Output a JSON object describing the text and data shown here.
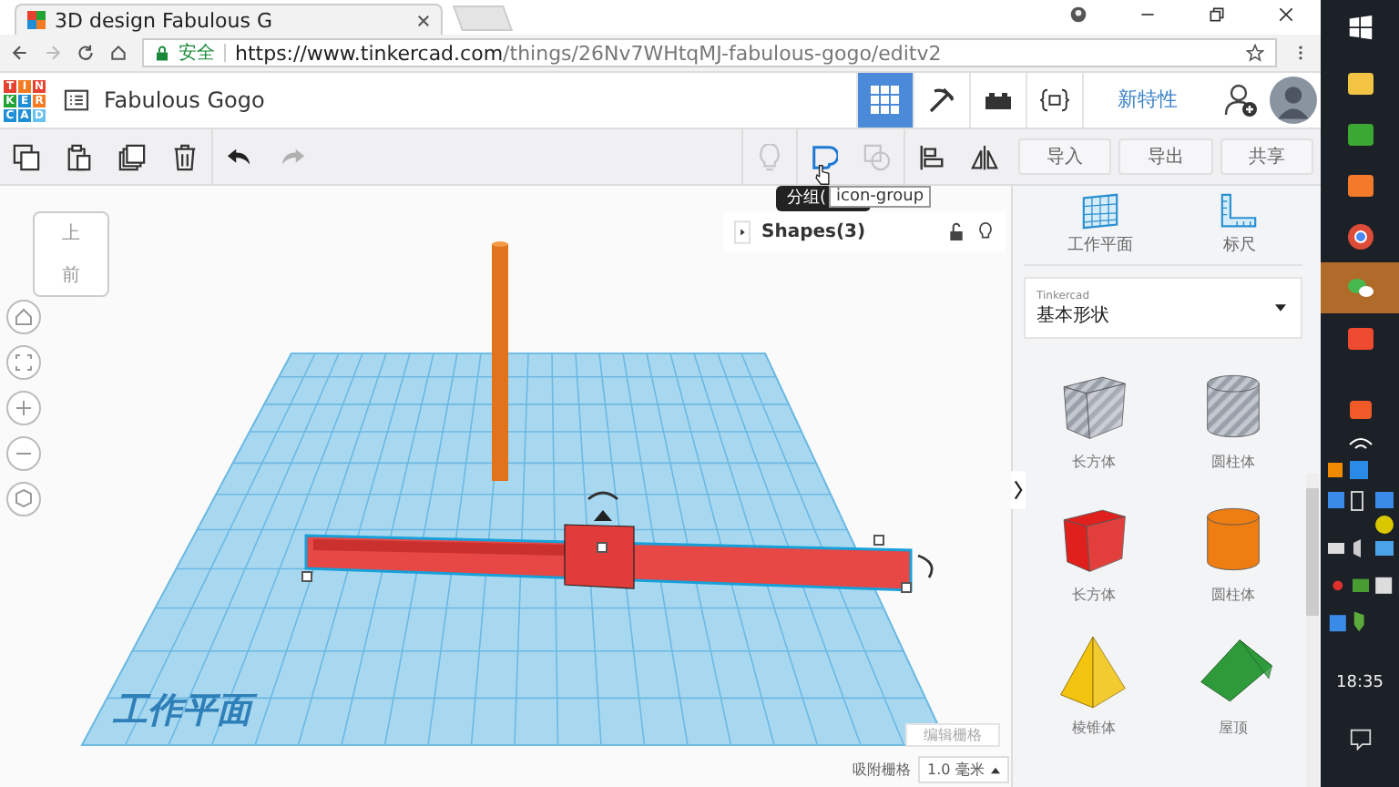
{
  "browser": {
    "tab_title": "3D design Fabulous G",
    "security": "安全",
    "url_host": "https://www.tinkercad.com",
    "url_path": "/things/26Nv7WHtqMJ-fabulous-gogo/editv2"
  },
  "header": {
    "logo_letters": [
      {
        "letter": "T",
        "color": "#e6422f"
      },
      {
        "letter": "I",
        "color": "#f47b20"
      },
      {
        "letter": "N",
        "color": "#e6422f"
      },
      {
        "letter": "K",
        "color": "#21a336"
      },
      {
        "letter": "E",
        "color": "#1e8fd6"
      },
      {
        "letter": "R",
        "color": "#f47b20"
      },
      {
        "letter": "C",
        "color": "#1e8fd6"
      },
      {
        "letter": "A",
        "color": "#1e8fd6"
      },
      {
        "letter": "D",
        "color": "#69c2ee"
      }
    ],
    "design_name": "Fabulous Gogo",
    "view_buttons": [
      {
        "kind": "grid",
        "selected": true
      },
      {
        "kind": "pickaxe",
        "selected": false
      },
      {
        "kind": "bricks",
        "selected": false
      },
      {
        "kind": "code",
        "selected": false
      }
    ],
    "whats_new": "新特性"
  },
  "toolbar": {
    "actions": [
      {
        "kind": "copy",
        "disabled": false
      },
      {
        "kind": "paste",
        "disabled": false
      },
      {
        "kind": "duplicate",
        "disabled": false
      },
      {
        "kind": "delete",
        "disabled": false
      },
      {
        "kind": "undo",
        "disabled": false
      },
      {
        "kind": "redo",
        "disabled": true
      }
    ],
    "tools": [
      {
        "kind": "bulb",
        "disabled": true
      },
      {
        "kind": "group",
        "disabled": false
      },
      {
        "kind": "ungroup",
        "disabled": true
      },
      {
        "kind": "align",
        "disabled": false
      },
      {
        "kind": "mirror",
        "disabled": false
      }
    ],
    "buttons": [
      "导入",
      "导出",
      "共享"
    ]
  },
  "viewport": {
    "view_cube": {
      "top": "上",
      "front": "前"
    },
    "shapes_panel": "Shapes(3)",
    "tooltip": "分组(",
    "hover_hint": "icon-group",
    "workplane_label": "工作平面",
    "edit_grid": "编辑栅格",
    "snap_label": "吸附栅格",
    "snap_value": "1.0 毫米"
  },
  "panel": {
    "tools": [
      {
        "kind": "workplane",
        "label": "工作平面"
      },
      {
        "kind": "ruler",
        "label": "标尺"
      }
    ],
    "library_source": "Tinkercad",
    "library": "基本形状",
    "shapes": [
      {
        "kind": "box",
        "label": "长方体",
        "color": "#c3c7ce",
        "hole": true
      },
      {
        "kind": "cylinder",
        "label": "圆柱体",
        "color": "#c3c7ce",
        "hole": true
      },
      {
        "kind": "box",
        "label": "长方体",
        "color": "#e0201c",
        "hole": false
      },
      {
        "kind": "cylinder",
        "label": "圆柱体",
        "color": "#ee7d12",
        "hole": false
      },
      {
        "kind": "pyramid",
        "label": "棱锥体",
        "color": "#f2c40f"
      },
      {
        "kind": "roof",
        "label": "屋顶",
        "color": "#2e9a3a"
      }
    ]
  },
  "taskbar": {
    "apps": [
      {
        "kind": "folder",
        "selected": false
      },
      {
        "kind": "letter-c",
        "selected": false
      },
      {
        "kind": "letter-p",
        "selected": false
      },
      {
        "kind": "chrome",
        "selected": false
      },
      {
        "kind": "chat",
        "selected": true
      },
      {
        "kind": "letter-c-square",
        "selected": false
      }
    ],
    "time": "18:35"
  }
}
